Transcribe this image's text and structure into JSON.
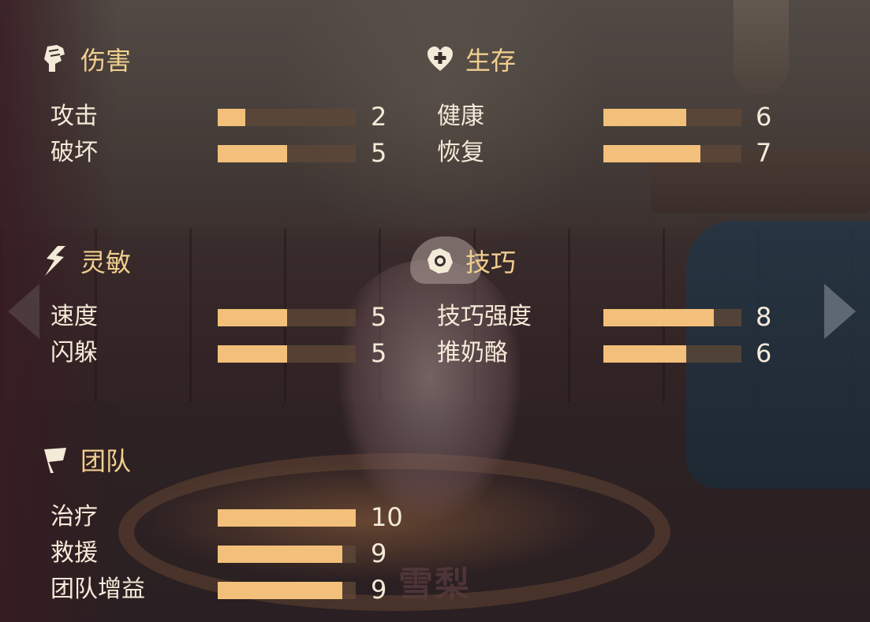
{
  "character_name": "雪梨",
  "max_stat": 10,
  "colors": {
    "title": "#f1cf8f",
    "text": "#f4ead8",
    "bar_fill": "#f2c07a",
    "bar_track": "#5f4837"
  },
  "sections": {
    "damage": {
      "title": "伤害",
      "icon": "fist-icon",
      "stats": [
        {
          "name": "攻击",
          "value": "2"
        },
        {
          "name": "破坏",
          "value": "5"
        }
      ]
    },
    "survival": {
      "title": "生存",
      "icon": "heart-plus-icon",
      "stats": [
        {
          "name": "健康",
          "value": "6"
        },
        {
          "name": "恢复",
          "value": "7"
        }
      ]
    },
    "agility": {
      "title": "灵敏",
      "icon": "lightning-icon",
      "stats": [
        {
          "name": "速度",
          "value": "5"
        },
        {
          "name": "闪躲",
          "value": "5"
        }
      ]
    },
    "skill": {
      "title": "技巧",
      "icon": "gear-icon",
      "stats": [
        {
          "name": "技巧强度",
          "value": "8"
        },
        {
          "name": "推奶酪",
          "value": "6"
        }
      ]
    },
    "team": {
      "title": "团队",
      "icon": "flag-icon",
      "stats": [
        {
          "name": "治疗",
          "value": "10"
        },
        {
          "name": "救援",
          "value": "9"
        },
        {
          "name": "团队增益",
          "value": "9"
        }
      ]
    }
  }
}
